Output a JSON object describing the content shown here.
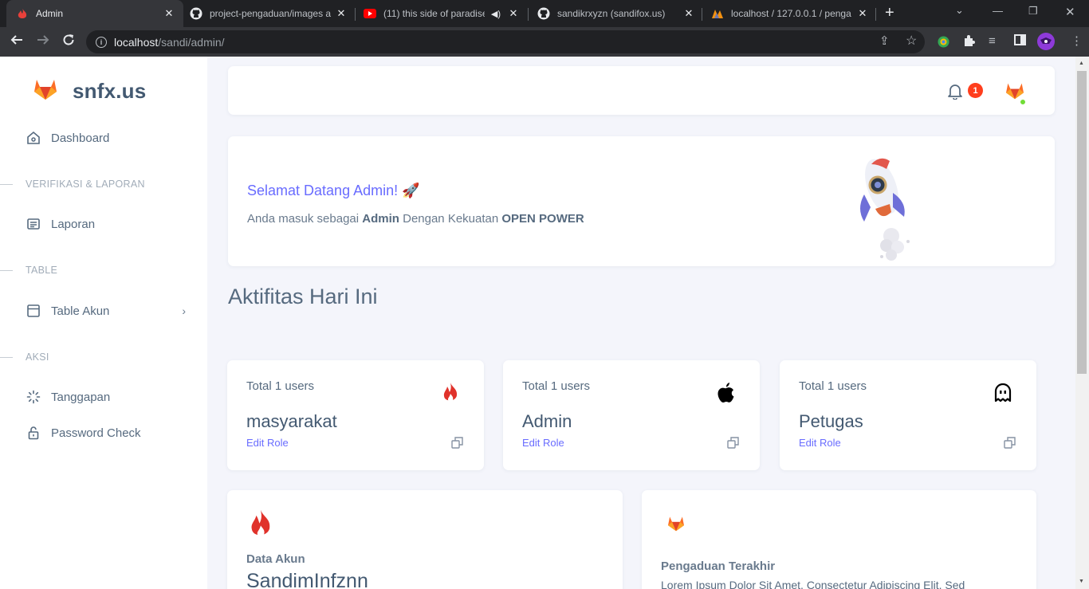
{
  "browser": {
    "tabs": [
      {
        "title": "Admin",
        "icon": "flame-icon"
      },
      {
        "title": "project-pengaduan/images a",
        "icon": "github-icon"
      },
      {
        "title": "(11) this side of paradise",
        "icon": "youtube-icon"
      },
      {
        "title": "sandikrxyzn (sandifox.us)",
        "icon": "github-icon"
      },
      {
        "title": "localhost / 127.0.0.1 / penga",
        "icon": "phpmyadmin-icon"
      }
    ],
    "url_host": "localhost",
    "url_path": "/sandi/admin/"
  },
  "sidebar": {
    "brand": "snfx.us",
    "items": {
      "dashboard": "Dashboard",
      "header_verifikasi": "VERIFIKASI & LAPORAN",
      "laporan": "Laporan",
      "header_table": "TABLE",
      "table_akun": "Table Akun",
      "header_aksi": "AKSI",
      "tanggapan": "Tanggapan",
      "password_check": "Password Check"
    }
  },
  "topnav": {
    "notification_count": "1"
  },
  "welcome": {
    "title": "Selamat Datang Admin! 🚀",
    "text_prefix": "Anda masuk sebagai ",
    "role": "Admin",
    "text_middle": " Dengan Kekuatan ",
    "power": "OPEN POWER"
  },
  "section_title": "Aktifitas Hari Ini",
  "stats": [
    {
      "total": "Total 1 users",
      "name": "masyarakat",
      "edit": "Edit Role",
      "icon": "flame-icon"
    },
    {
      "total": "Total 1 users",
      "name": "Admin",
      "edit": "Edit Role",
      "icon": "apple-icon"
    },
    {
      "total": "Total 1 users",
      "name": "Petugas",
      "edit": "Edit Role",
      "icon": "ghost-icon"
    }
  ],
  "data_akun": {
    "label": "Data Akun",
    "value": "SandimInfznn"
  },
  "pengaduan": {
    "label": "Pengaduan Terakhir",
    "text": "Lorem Ipsum Dolor Sit Amet, Consectetur Adipiscing Elit. Sed"
  },
  "colors": {
    "primary": "#696cff",
    "heading": "#566a7f",
    "danger": "#ff3e1d",
    "success": "#71dd37"
  }
}
